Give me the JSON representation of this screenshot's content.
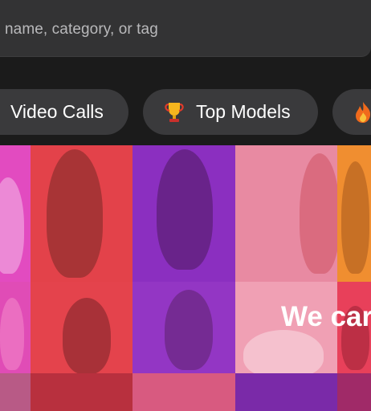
{
  "search": {
    "placeholder": "name, category, or tag"
  },
  "categories": [
    {
      "label": "Video Calls",
      "icon": "video-icon"
    },
    {
      "label": "Top Models",
      "icon": "trophy-icon"
    },
    {
      "label": "",
      "icon": "fire-icon"
    }
  ],
  "banner": {
    "headline": "We car"
  },
  "colors": {
    "background": "#1b1b1b",
    "search_bar": "#333334",
    "pill": "#3a3a3c",
    "text": "#ffffff",
    "magenta": "#e040b8",
    "red": "#e8393f",
    "purple": "#8a30c8",
    "pink": "#f08aa0",
    "orange": "#f0902a"
  }
}
